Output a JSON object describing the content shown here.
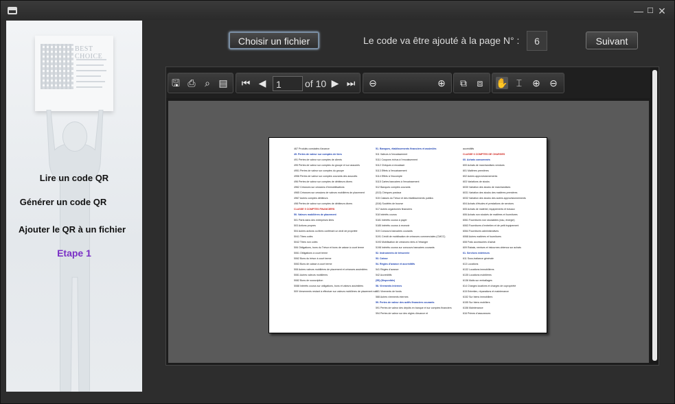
{
  "window": {
    "minimize": "—",
    "maximize": "☐",
    "close": "✕"
  },
  "sidebar": {
    "board_title": "BEST CHOICE",
    "items": [
      {
        "label": "Lire un code QR"
      },
      {
        "label": "Générer un code QR"
      },
      {
        "label": "Ajouter le QR à un fichier"
      }
    ],
    "step": "Etape 1",
    "step_color": "#7a2fc6"
  },
  "header": {
    "choose_file": "Choisir un fichier",
    "page_label": "Le code va être ajouté à la page N° :",
    "page_value": "6",
    "next": "Suivant"
  },
  "viewer": {
    "current_page": "1",
    "of_pages": "of 10",
    "icons": [
      "save-icon",
      "print-icon",
      "print-preview-icon",
      "properties-icon",
      "first-page-icon",
      "prev-page-icon",
      "next-page-icon",
      "last-page-icon",
      "zoom-out-icon",
      "zoom-in-icon",
      "fit-page-icon",
      "fit-width-icon",
      "hand-tool-icon",
      "text-select-icon",
      "zoom-tool-in-icon",
      "zoom-tool-out-icon"
    ]
  },
  "document": {
    "col1": [
      {
        "t": "467   Produits constatés d'avance",
        "c": ""
      },
      {
        "t": "49.   Pertes de valeur sur comptes de tiers",
        "c": "blue"
      },
      {
        "t": "491   Pertes de valeur sur comptes de clients",
        "c": ""
      },
      {
        "t": "495   Pertes de valeur sur comptes du groupe et sur associés",
        "c": ""
      },
      {
        "t": "4951  Pertes de valeur sur comptes du groupe",
        "c": ""
      },
      {
        "t": "4956  Pertes de valeur sur comptes courants des associés",
        "c": ""
      },
      {
        "t": "496   Pertes de valeur sur comptes de débiteurs divers",
        "c": ""
      },
      {
        "t": "4962  Créances sur cessions d'immobilisations",
        "c": ""
      },
      {
        "t": "4965  Créances sur cessions de valeurs mobilières de placement",
        "c": ""
      },
      {
        "t": "4967  Autres comptes débiteurs",
        "c": ""
      },
      {
        "t": "498   Pertes de valeur sur comptes de débiteurs divers",
        "c": ""
      },
      {
        "t": "CLASSE 5     COMPTES FINANCIERS",
        "c": "red"
      },
      {
        "t": "50.   Valeurs mobilières de placement",
        "c": "blue"
      },
      {
        "t": "501   Parts dans des entreprises liées",
        "c": ""
      },
      {
        "t": "503   Actions propres",
        "c": ""
      },
      {
        "t": "504   Autres actions ou titres conférant un droit de propriété",
        "c": ""
      },
      {
        "t": "5041  Titres cotés",
        "c": ""
      },
      {
        "t": "5042  Titres non cotés",
        "c": ""
      },
      {
        "t": "506   Obligations, bons du Trésor et bons de caisse à court terme",
        "c": ""
      },
      {
        "t": "5061  Obligations à court terme",
        "c": ""
      },
      {
        "t": "5062  Bons du trésor à court terme",
        "c": ""
      },
      {
        "t": "5063  Bons de caisse à court terme",
        "c": ""
      },
      {
        "t": "508   Autres valeurs mobilières de placement et créances assimilées",
        "c": ""
      },
      {
        "t": "5081  Autres valeurs mobilières",
        "c": ""
      },
      {
        "t": "5082  Bons de souscription",
        "c": ""
      },
      {
        "t": "5088  Intérêts courus sur obligations, bons et valeurs assimilées",
        "c": ""
      },
      {
        "t": "509   Versements restant à effectuer sur valeurs mobilières de placement non libérées",
        "c": ""
      }
    ],
    "col2": [
      {
        "t": "51.   Banques, établissements financiers et assimilés",
        "c": "blue"
      },
      {
        "t": "511   Valeurs à l'encaissement",
        "c": ""
      },
      {
        "t": "5111  Coupons échus à l'encaissement",
        "c": ""
      },
      {
        "t": "5112  Chèques à encaisser",
        "c": ""
      },
      {
        "t": "5113  Effets à l'encaissement",
        "c": ""
      },
      {
        "t": "5114  Effets à l'escompte",
        "c": ""
      },
      {
        "t": "5115  Cartes bancaires à l'encaissement",
        "c": ""
      },
      {
        "t": "512   Banques comptes courants",
        "c": ""
      },
      {
        "t": "(513) Chèques postaux",
        "c": ""
      },
      {
        "t": "515   Caisses du Trésor et des établissements publics",
        "c": ""
      },
      {
        "t": "(516) Sociétés de bourse",
        "c": ""
      },
      {
        "t": "517   Autres organismes financiers",
        "c": ""
      },
      {
        "t": "518   Intérêts courus",
        "c": ""
      },
      {
        "t": "5181  Intérêts courus à payer",
        "c": ""
      },
      {
        "t": "5185  Intérêts courus à recevoir",
        "c": ""
      },
      {
        "t": "519   Concours bancaires courants",
        "c": ""
      },
      {
        "t": "5191  Crédit de mobilisation de créances commerciales (CMCC)",
        "c": ""
      },
      {
        "t": "5193  Mobilisation de créances nées à l'étranger",
        "c": ""
      },
      {
        "t": "5198  Intérêts courus sur concours bancaires courants",
        "c": ""
      },
      {
        "t": "52.   Instruments de trésorerie",
        "c": "blue"
      },
      {
        "t": "53.   Caisse",
        "c": "blue"
      },
      {
        "t": "54.   Régies d'avance et accréditifs",
        "c": "blue"
      },
      {
        "t": "541   Régies d'avance",
        "c": ""
      },
      {
        "t": "542   Accréditifs",
        "c": ""
      },
      {
        "t": "(55)  (Disponible)",
        "c": "blue"
      },
      {
        "t": "58.   Virements internes",
        "c": "blue"
      },
      {
        "t": "581   Virements de fonds",
        "c": ""
      },
      {
        "t": "588   Autres virements internes",
        "c": ""
      },
      {
        "t": "59.   Pertes de valeur des actifs financiers courants",
        "c": "blue"
      },
      {
        "t": "591   Pertes de valeur des dépôts en banque et sur comptes financiers",
        "c": ""
      },
      {
        "t": "594   Pertes de valeur sur des régies d'avance et",
        "c": ""
      }
    ],
    "col3": [
      {
        "t": "accréditifs",
        "c": ""
      },
      {
        "t": "CLASSE 6     COMPTES DE CHARGES",
        "c": "red"
      },
      {
        "t": "60.   Achats consommés",
        "c": "blue"
      },
      {
        "t": "600   Achats de marchandises vendues",
        "c": ""
      },
      {
        "t": "601   Matières premières",
        "c": ""
      },
      {
        "t": "602   Autres approvisionnements",
        "c": ""
      },
      {
        "t": "603   Variations de stocks",
        "c": ""
      },
      {
        "t": "6030  Variation des stocks de marchandises",
        "c": ""
      },
      {
        "t": "6031  Variation des stocks des matières premières",
        "c": ""
      },
      {
        "t": "6032  Variation des stocks des autres approvisionnements",
        "c": ""
      },
      {
        "t": "604   Achats d'études et prestations de services",
        "c": ""
      },
      {
        "t": "605   Achats de matériel, équipements et travaux",
        "c": ""
      },
      {
        "t": "606   Achats non stockés de matières et fournitures",
        "c": ""
      },
      {
        "t": "6061  Fournitures non stockables (eau, énergie)",
        "c": ""
      },
      {
        "t": "6063  Fournitures d'entretien et de petit équipement",
        "c": ""
      },
      {
        "t": "6064  Fournitures administratives",
        "c": ""
      },
      {
        "t": "6068  Autres matières et fournitures",
        "c": ""
      },
      {
        "t": "608   Frais accessoires d'achat",
        "c": ""
      },
      {
        "t": "609   Rabais, remises et ristournes obtenus sur achats",
        "c": ""
      },
      {
        "t": "61.   Services extérieurs",
        "c": "blue"
      },
      {
        "t": "611   Sous-traitance générale",
        "c": ""
      },
      {
        "t": "613   Locations",
        "c": ""
      },
      {
        "t": "6132  Locations immobilières",
        "c": ""
      },
      {
        "t": "6135  Locations mobilières",
        "c": ""
      },
      {
        "t": "6136  Malis sur emballages",
        "c": ""
      },
      {
        "t": "614   Charges locatives et charges de copropriété",
        "c": ""
      },
      {
        "t": "615   Entretien, réparations et maintenance",
        "c": ""
      },
      {
        "t": "6152  Sur biens immobiliers",
        "c": ""
      },
      {
        "t": "6155  Sur biens mobiliers",
        "c": ""
      },
      {
        "t": "6156  Maintenance",
        "c": ""
      },
      {
        "t": "616   Primes d'assurances",
        "c": ""
      }
    ]
  }
}
